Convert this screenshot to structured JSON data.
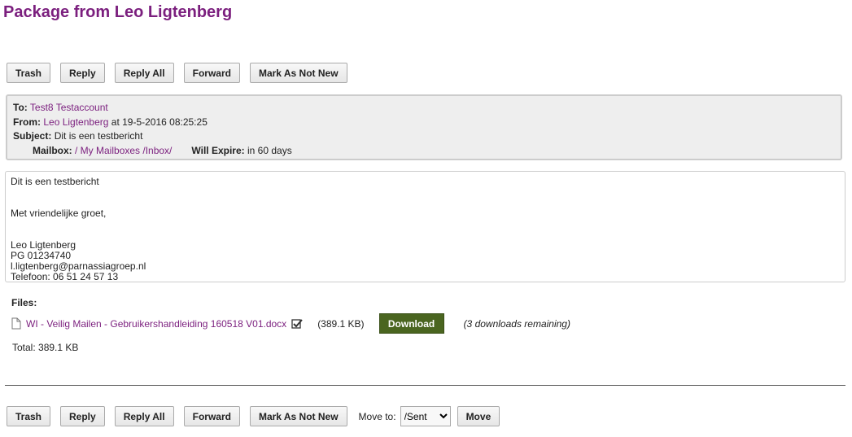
{
  "title": "Package from Leo Ligtenberg",
  "toolbar": {
    "trash": "Trash",
    "reply": "Reply",
    "reply_all": "Reply All",
    "forward": "Forward",
    "mark_not_new": "Mark As Not New",
    "move_to_label": "Move to:",
    "move_to_value": "/Sent",
    "move": "Move"
  },
  "header": {
    "to_label": "To:",
    "to": "Test8 Testaccount",
    "from_label": "From:",
    "from": "Leo Ligtenberg",
    "at": "at 19-5-2016 08:25:25",
    "subject_label": "Subject:",
    "subject": "Dit is een testbericht",
    "mailbox_label": "Mailbox:",
    "mailbox": "/ My Mailboxes /Inbox/",
    "expire_label": "Will Expire:",
    "expire": "in 60 days"
  },
  "body": {
    "lines": [
      "Dit is een testbericht",
      "",
      "",
      "Met vriendelijke groet,",
      "",
      "",
      "Leo Ligtenberg",
      "PG 01234740",
      "l.ligtenberg@parnassiagroep.nl",
      "Telefoon: 06 51 24 57 13"
    ]
  },
  "files": {
    "label": "Files:",
    "items": [
      {
        "name": "WI - Veilig Mailen - Gebruikershandleiding 160518 V01.docx",
        "size": "(389.1 KB)",
        "download": "Download",
        "remaining": "(3 downloads remaining)"
      }
    ],
    "total": "Total: 389.1 KB"
  },
  "colors": {
    "accent": "#7b1f7e",
    "download": "#4a6520"
  }
}
